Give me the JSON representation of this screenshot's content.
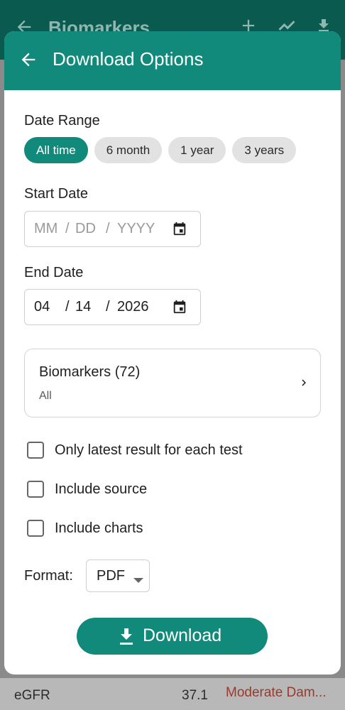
{
  "background": {
    "title": "Biomarkers",
    "icons": [
      "back-arrow-icon",
      "plus-icon",
      "trend-icon",
      "download-icon"
    ],
    "row": {
      "name": "eGFR",
      "value": "37.1",
      "status": "Moderate Dam..."
    }
  },
  "modal": {
    "title": "Download Options",
    "date_range": {
      "label": "Date Range",
      "options": [
        "All time",
        "6 month",
        "1 year",
        "3 years"
      ],
      "selected": "All time"
    },
    "start_date": {
      "label": "Start Date",
      "month": "MM",
      "day": "DD",
      "year": "YYYY",
      "separator": "/"
    },
    "end_date": {
      "label": "End Date",
      "month": "04",
      "day": "14",
      "year": "2026",
      "separator": "/"
    },
    "biomarkers": {
      "title": "Biomarkers (72)",
      "subtitle": "All"
    },
    "options": {
      "latest_only": "Only latest result for each test",
      "include_source": "Include source",
      "include_charts": "Include charts"
    },
    "format": {
      "label": "Format:",
      "value": "PDF"
    },
    "download_label": "Download"
  },
  "colors": {
    "primary": "#128a7b",
    "chip_inactive": "#e2e2e2",
    "overlay": "#7a7a7a"
  }
}
